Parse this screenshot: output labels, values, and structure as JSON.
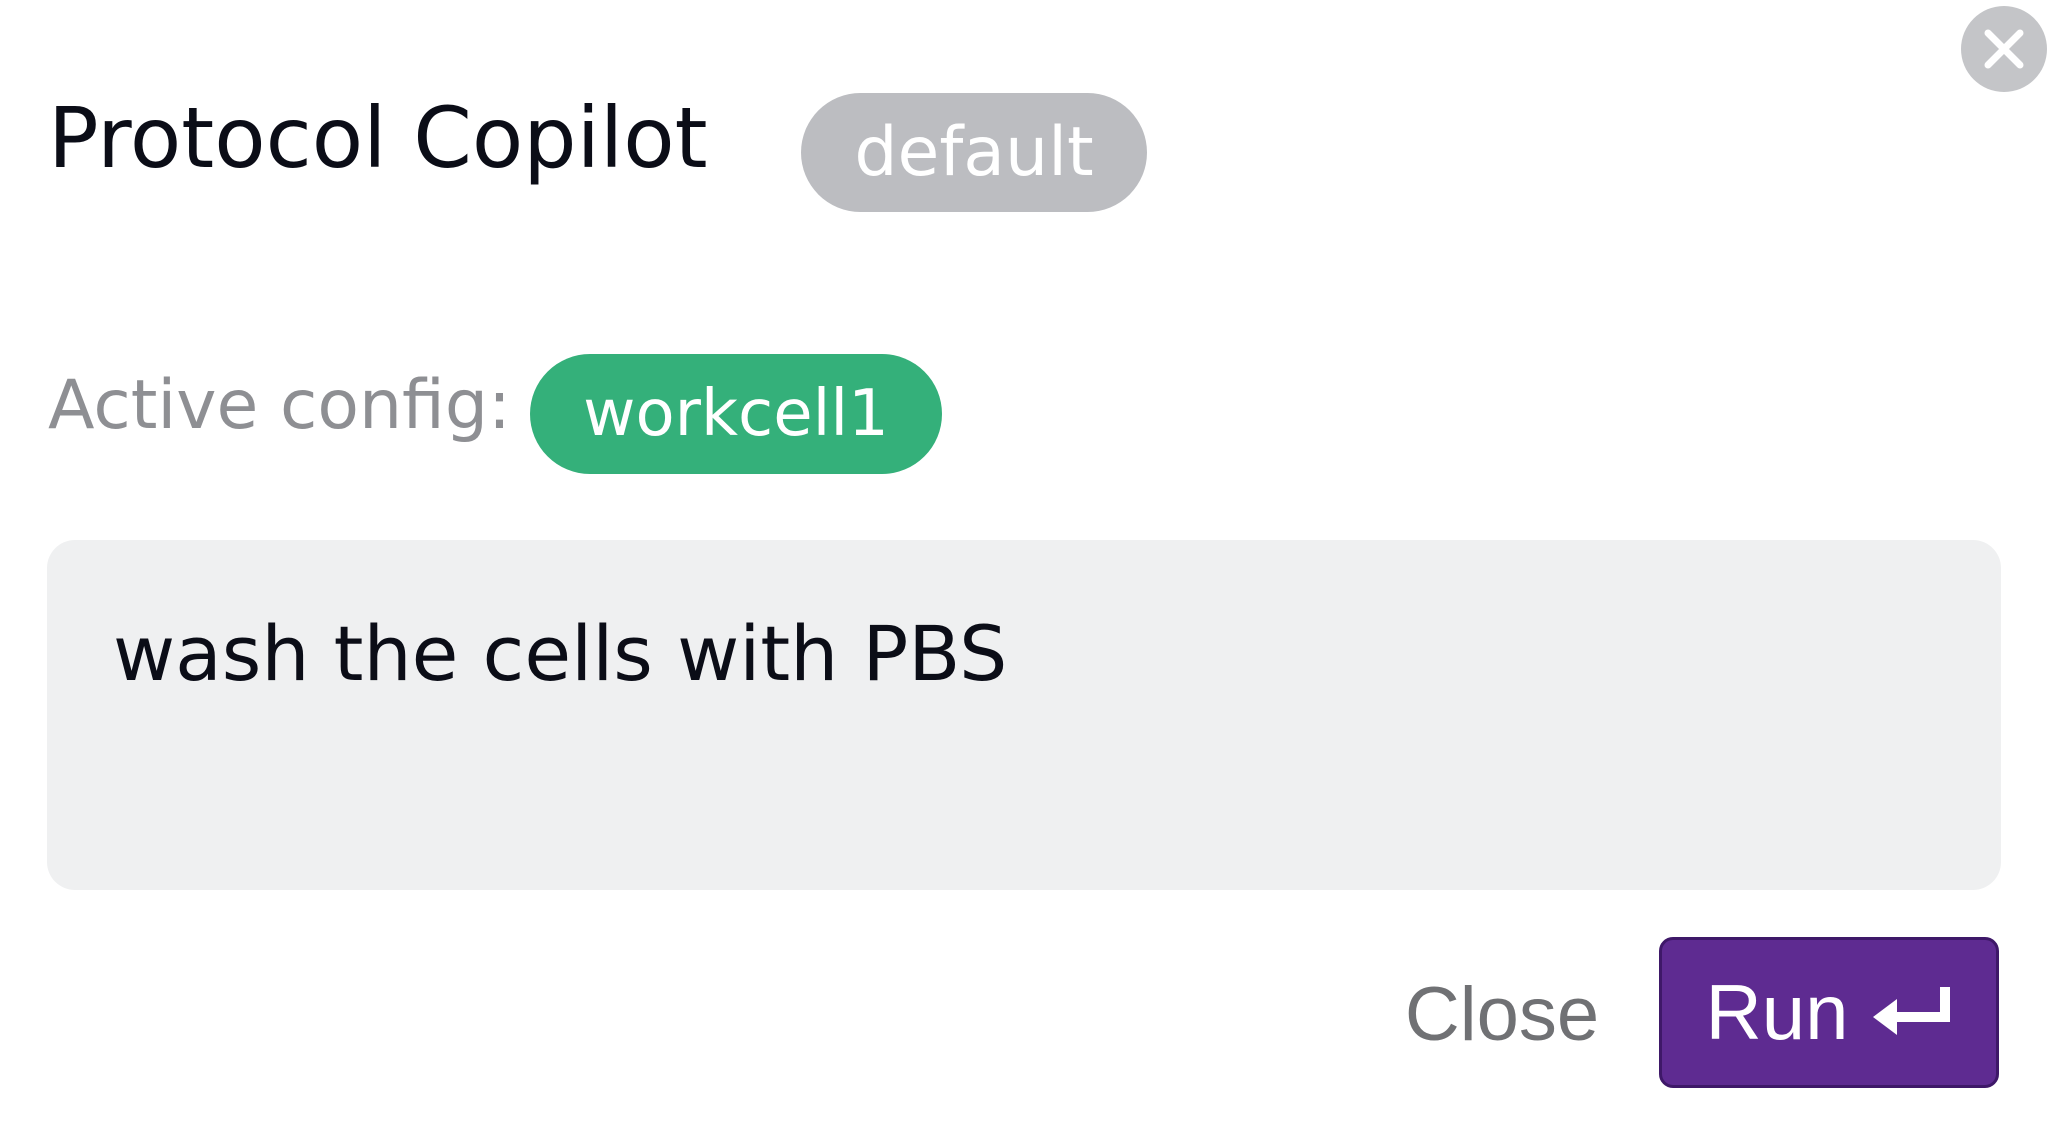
{
  "header": {
    "title": "Protocol Copilot",
    "badge": "default",
    "close_icon": "close-icon"
  },
  "config": {
    "label": "Active config:",
    "value": "workcell1"
  },
  "prompt": {
    "value": "wash the cells with PBS"
  },
  "footer": {
    "close_label": "Close",
    "run_label": "Run",
    "run_icon": "enter-return-icon"
  },
  "colors": {
    "accent": "#5e2b91",
    "config_badge": "#34b07a",
    "default_badge": "#bcbdc1"
  }
}
